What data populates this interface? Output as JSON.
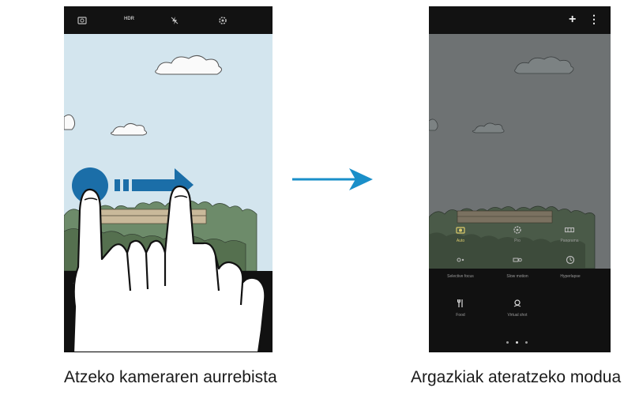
{
  "left_phone": {
    "top_icons": [
      "camera-switch-icon",
      "hdr-icon",
      "flash-off-icon",
      "settings-icon"
    ],
    "hdr_label": "HDR",
    "bottom_icon": "gallery-icon"
  },
  "right_phone": {
    "top_icons": [
      "add-icon",
      "more-options-icon"
    ],
    "add_glyph": "+",
    "more_glyph": "⋮",
    "modes": [
      {
        "icon": "auto-mode-icon",
        "label": "Auto",
        "active": true
      },
      {
        "icon": "pro-mode-icon",
        "label": "Pro",
        "active": false
      },
      {
        "icon": "panorama-mode-icon",
        "label": "Panorama",
        "active": false
      },
      {
        "icon": "selective-focus-mode-icon",
        "label": "Selective focus",
        "active": false
      },
      {
        "icon": "slow-motion-mode-icon",
        "label": "Slow motion",
        "active": false
      },
      {
        "icon": "hyperlapse-mode-icon",
        "label": "Hyperlapse",
        "active": false
      },
      {
        "icon": "food-mode-icon",
        "label": "Food",
        "active": false
      },
      {
        "icon": "virtual-shot-mode-icon",
        "label": "Virtual shot",
        "active": false
      }
    ],
    "page_dots": 3
  },
  "colors": {
    "arrow_blue": "#1a8fc9",
    "swipe_blue": "#1b6ea8",
    "active_mode": "#d9c96a",
    "sky": "#d3e5ee"
  },
  "captions": {
    "left": "Atzeko kameraren aurrebista",
    "right": "Argazkiak ateratzeko modua"
  }
}
